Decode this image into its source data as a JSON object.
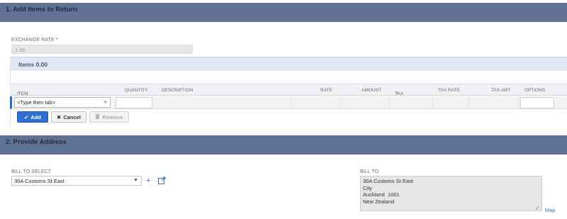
{
  "sections": {
    "add_items": "1. Add Items to Return",
    "provide_address": "2. Provide Address"
  },
  "exchange_rate": {
    "label": "EXCHANGE RATE",
    "required_mark": "*",
    "value": "1.00"
  },
  "items": {
    "heading": "Items 0.00",
    "columns": {
      "item": "ITEM",
      "item_req": "*",
      "quantity": "QUANTITY",
      "description": "DESCRIPTION",
      "rate": "RATE",
      "amount": "AMOUNT",
      "tax_code": "TAX CODE",
      "tax_code_req": "*",
      "tax_rate": "TAX RATE",
      "tax_amt": "TAX AMT",
      "options": "OPTIONS"
    },
    "item_placeholder": "<Type then tab>",
    "buttons": {
      "add": "Add",
      "cancel": "Cancel",
      "remove": "Remove"
    }
  },
  "address": {
    "bill_to_select_label": "BILL TO SELECT",
    "bill_to_select_value": "30A Customs St East",
    "bill_to_label": "BILL TO",
    "bill_to_lines": [
      "30A Customs St East",
      "City",
      "Auckland  1001",
      "New Zealand"
    ],
    "map_link": "Map"
  },
  "icons": {
    "add_icon": "plus-icon",
    "open_icon": "external-link-icon"
  },
  "colors": {
    "section_bar": "#5f7293",
    "primary_button": "#2f6ed2",
    "link": "#3e6fb6"
  }
}
